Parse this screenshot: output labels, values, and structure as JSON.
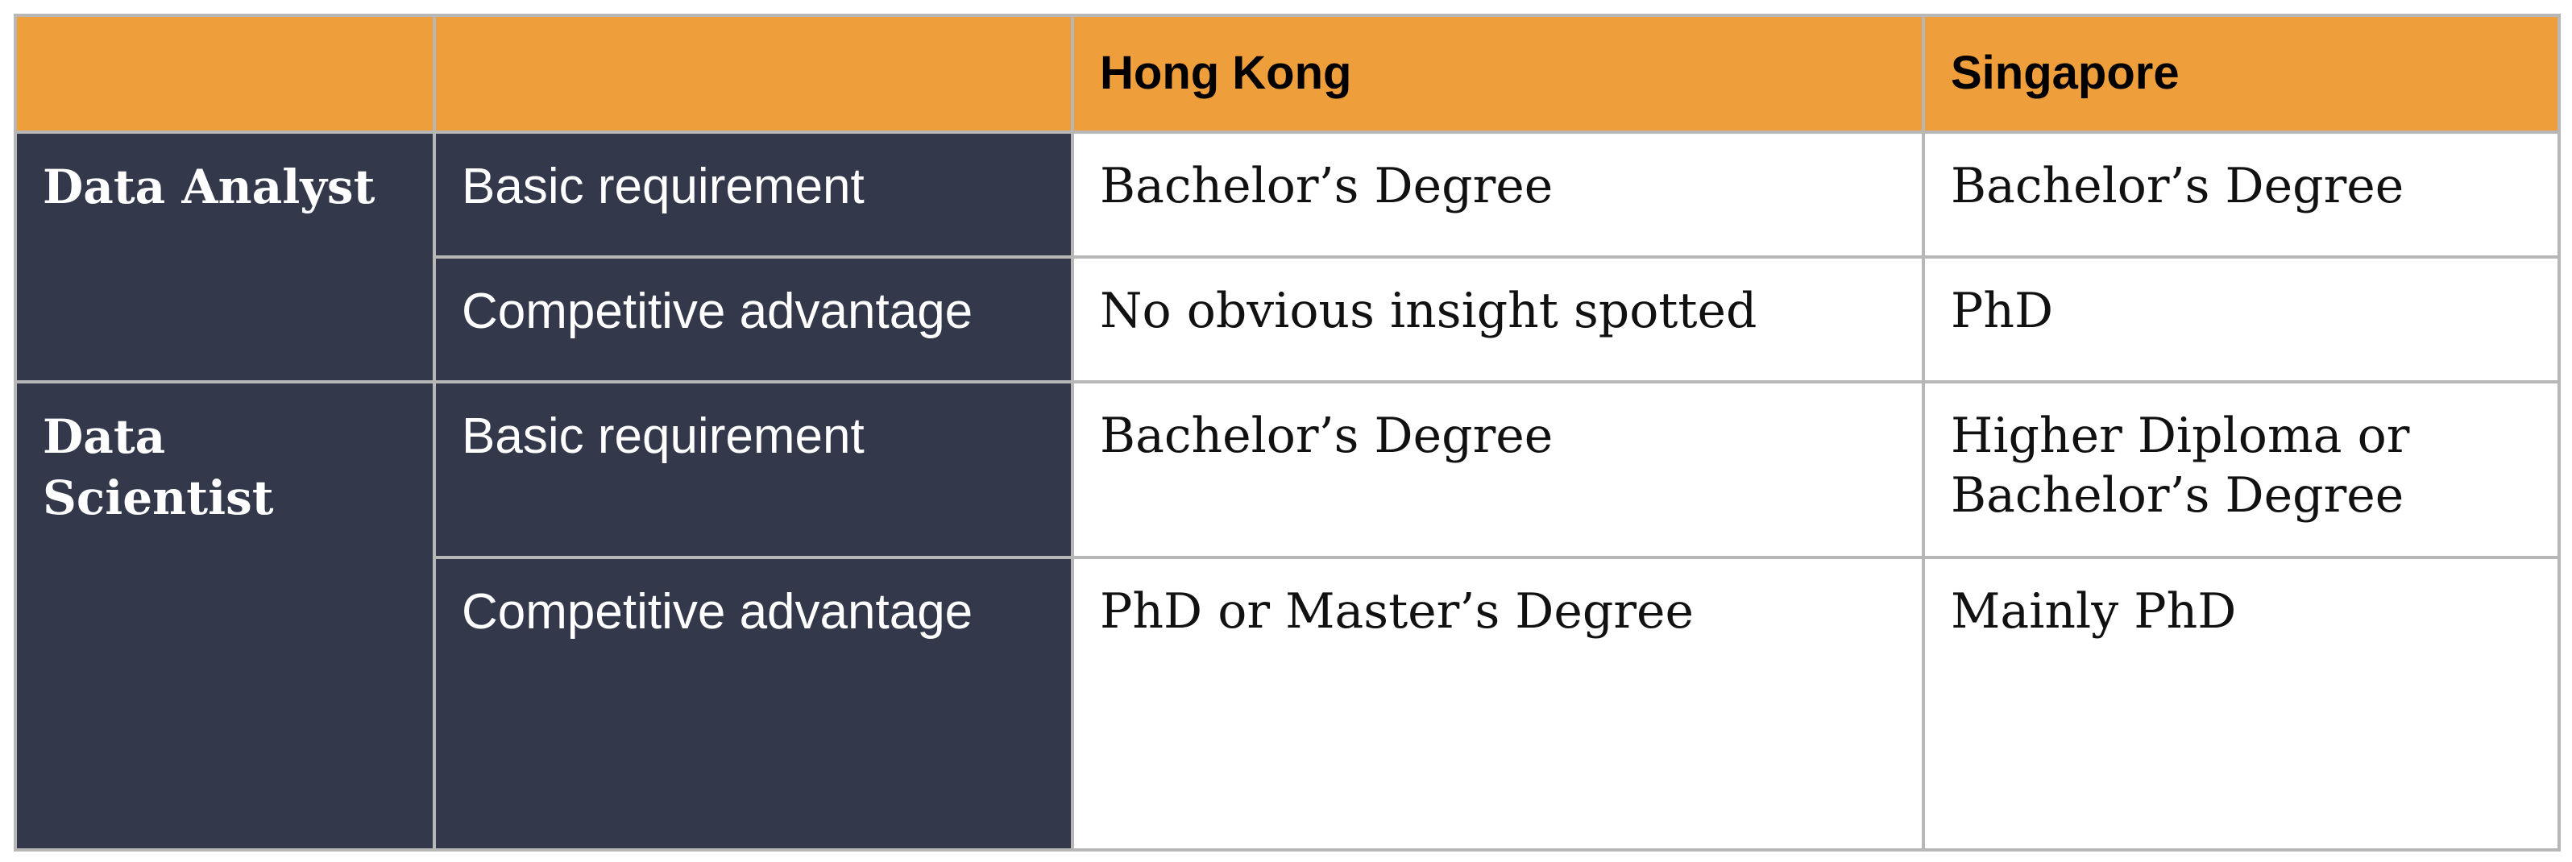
{
  "table": {
    "header": {
      "blank_1": "",
      "blank_2": "",
      "col_hong_kong": "Hong Kong",
      "col_singapore": "Singapore"
    },
    "groups": [
      {
        "role": "Data Analyst",
        "rows": [
          {
            "aspect": "Basic requirement",
            "hong_kong": "Bachelor’s Degree",
            "singapore": "Bachelor’s Degree"
          },
          {
            "aspect": "Competitive advantage",
            "hong_kong": "No obvious insight spotted",
            "singapore": "PhD"
          }
        ]
      },
      {
        "role": "Data Scientist",
        "rows": [
          {
            "aspect": "Basic requirement",
            "hong_kong": "Bachelor’s Degree",
            "singapore": "Higher Diploma or Bachelor’s Degree"
          },
          {
            "aspect": "Competitive advantage",
            "hong_kong": "PhD or Master’s Degree",
            "singapore": "Mainly PhD"
          }
        ]
      }
    ],
    "colors": {
      "header_bg": "#ee9e3a",
      "label_bg": "#33384b",
      "border": "#b7b7b7"
    }
  }
}
